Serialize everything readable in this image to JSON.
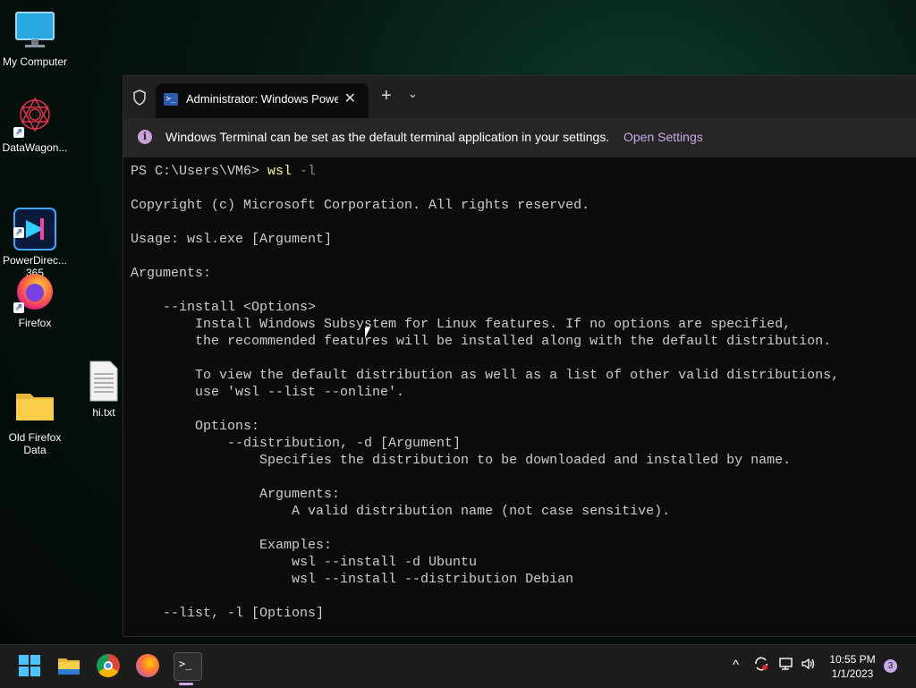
{
  "desktop": {
    "icons": [
      {
        "label": "My Computer"
      },
      {
        "label": "DataWagon..."
      },
      {
        "label": "PowerDirec...\n365"
      },
      {
        "label": "Firefox"
      },
      {
        "label": "Old Firefox\nData"
      },
      {
        "label": "hi.txt"
      }
    ]
  },
  "terminal": {
    "tab_title": "Administrator: Windows PowerShell",
    "tab_close": "✕",
    "new_tab": "+",
    "tab_dropdown": "⌄",
    "info_icon": "i",
    "info_message": "Windows Terminal can be set as the default terminal application in your settings.",
    "info_action": "Open Settings",
    "prompt": "PS C:\\Users\\VM6> ",
    "command": "wsl",
    "command_arg": " -l",
    "output": "\nCopyright (c) Microsoft Corporation. All rights reserved.\n\nUsage: wsl.exe [Argument]\n\nArguments:\n\n    --install <Options>\n        Install Windows Subsystem for Linux features. If no options are specified,\n        the recommended features will be installed along with the default distribution.\n\n        To view the default distribution as well as a list of other valid distributions,\n        use 'wsl --list --online'.\n\n        Options:\n            --distribution, -d [Argument]\n                Specifies the distribution to be downloaded and installed by name.\n\n                Arguments:\n                    A valid distribution name (not case sensitive).\n\n                Examples:\n                    wsl --install -d Ubuntu\n                    wsl --install --distribution Debian\n\n    --list, -l [Options]"
  },
  "taskbar": {
    "apps": [
      "start-icon",
      "file-explorer-icon",
      "chrome-icon",
      "firefox-icon",
      "terminal-icon"
    ],
    "tray": {
      "chevron": "^",
      "time": "10:55 PM",
      "date": "1/1/2023",
      "notification_count": "3"
    }
  },
  "colors": {
    "accent": "#c9a9e9",
    "console_bg": "#0c0c0c",
    "command_yellow": "#f9f1a5"
  }
}
